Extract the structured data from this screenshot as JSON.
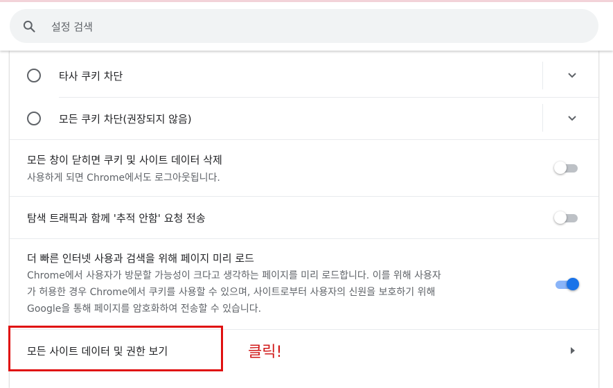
{
  "search": {
    "placeholder": "설정 검색",
    "value": ""
  },
  "cookie_options": [
    {
      "label": "타사 쿠키 차단",
      "selected": false
    },
    {
      "label": "모든 쿠키 차단(권장되지 않음)",
      "selected": false
    }
  ],
  "settings": {
    "clear_on_exit": {
      "label": "모든 창이 닫히면 쿠키 및 사이트 데이터 삭제",
      "sublabel": "사용하게 되면 Chrome에서도 로그아웃됩니다.",
      "enabled": false
    },
    "do_not_track": {
      "label": "탐색 트래픽과 함께 '추적 안함' 요청 전송",
      "enabled": false
    },
    "preload": {
      "label": "더 빠른 인터넷 사용과 검색을 위해 페이지 미리 로드",
      "sublabel_lines": [
        "Chrome에서 사용자가 방문할 가능성이 크다고 생각하는 페이지를 미리 로드합니다. 이를 위해 사용자",
        "가 허용한 경우 Chrome에서 쿠키를 사용할 수 있으며, 사이트로부터 사용자의 신원을 보호하기 위해",
        "Google을 통해 페이지를 암호화하여 전송할 수 있습니다."
      ],
      "enabled": true
    },
    "site_data": {
      "label": "모든 사이트 데이터 및 권한 보기"
    }
  },
  "annotation": {
    "text": "클릭!",
    "color": "#d01818"
  },
  "colors": {
    "accent": "#1a73e8",
    "toggle_off_knob": "#ffffff",
    "toggle_off_track": "#bdc1c6"
  },
  "icons": {
    "search": "search-icon",
    "expand": "chevron-down-icon",
    "subpage": "arrow-right-icon"
  }
}
